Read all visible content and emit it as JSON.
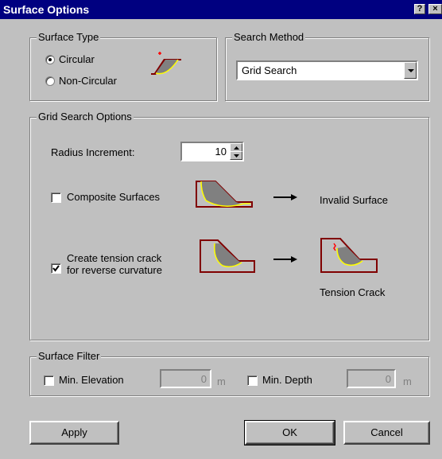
{
  "window": {
    "title": "Surface Options",
    "help_label": "?",
    "close_label": "×"
  },
  "surface_type": {
    "label": "Surface Type",
    "options": [
      "Circular",
      "Non-Circular"
    ],
    "selected": "Circular"
  },
  "search_method": {
    "label": "Search Method",
    "value": "Grid Search"
  },
  "grid_search": {
    "label": "Grid Search Options",
    "radius_label": "Radius Increment:",
    "radius_value": "10",
    "composite_label": "Composite Surfaces",
    "composite_checked": false,
    "invalid_surface_label": "Invalid Surface",
    "tension_label_line1": "Create tension crack",
    "tension_label_line2": "for reverse curvature",
    "tension_checked": true,
    "tension_crack_caption": "Tension Crack"
  },
  "surface_filter": {
    "label": "Surface Filter",
    "min_elevation_label": "Min. Elevation",
    "min_elevation_value": "0",
    "min_depth_label": "Min. Depth",
    "min_depth_value": "0",
    "unit": "m"
  },
  "buttons": {
    "apply": "Apply",
    "ok": "OK",
    "cancel": "Cancel"
  },
  "colors": {
    "title_bar": "#000080",
    "slope_outline": "#800000",
    "slide_mass": "#808080",
    "slip_surface": "#ffff00",
    "crack": "#ff0000"
  }
}
